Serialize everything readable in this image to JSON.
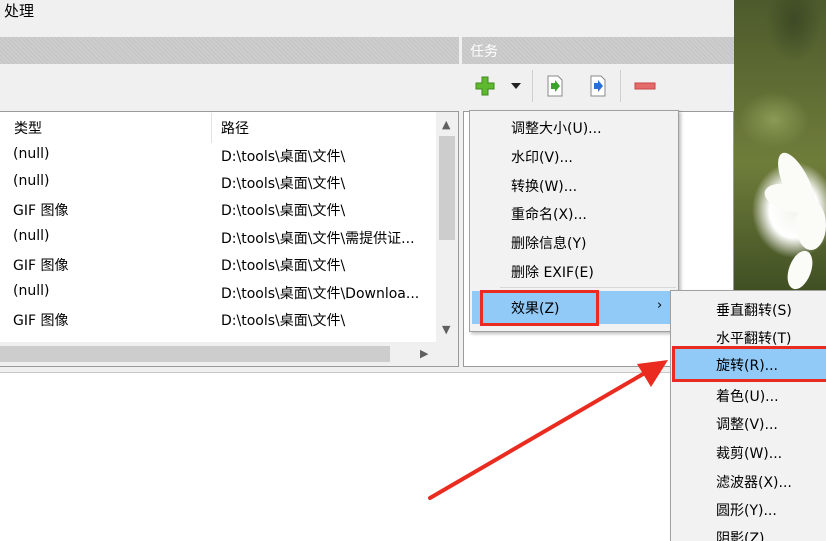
{
  "window": {
    "title": "处理"
  },
  "task_panel": {
    "header": "任务"
  },
  "file_list": {
    "columns": {
      "type": "类型",
      "path": "路径"
    },
    "rows": [
      {
        "type": "(null)",
        "path": "D:\\tools\\桌面\\文件\\"
      },
      {
        "type": "(null)",
        "path": "D:\\tools\\桌面\\文件\\"
      },
      {
        "type": "GIF 图像",
        "path": "D:\\tools\\桌面\\文件\\"
      },
      {
        "type": "(null)",
        "path": "D:\\tools\\桌面\\文件\\需提供证..."
      },
      {
        "type": "GIF 图像",
        "path": "D:\\tools\\桌面\\文件\\"
      },
      {
        "type": "(null)",
        "path": "D:\\tools\\桌面\\文件\\Downloa..."
      },
      {
        "type": "GIF 图像",
        "path": "D:\\tools\\桌面\\文件\\"
      }
    ]
  },
  "main_menu": {
    "items": [
      "调整大小(U)...",
      "水印(V)...",
      "转换(W)...",
      "重命名(X)...",
      "删除信息(Y)",
      "删除 EXIF(E)"
    ],
    "effects_label": "效果(Z)"
  },
  "effects_submenu": {
    "items": [
      "垂直翻转(S)",
      "水平翻转(T)",
      "旋转(R)...",
      "着色(U)...",
      "调整(V)...",
      "裁剪(W)...",
      "滤波器(X)...",
      "圆形(Y)...",
      "阴影(Z)"
    ],
    "highlighted": "旋转(R)..."
  },
  "colors": {
    "highlight": "#91c9f7",
    "annotation_red": "#ea2b1f",
    "add_green": "#5fb92e",
    "remove_red": "#e46b6b"
  },
  "icons": [
    "add-task-icon",
    "dropdown-arrow-icon",
    "import-icon",
    "export-icon",
    "remove-task-icon"
  ]
}
